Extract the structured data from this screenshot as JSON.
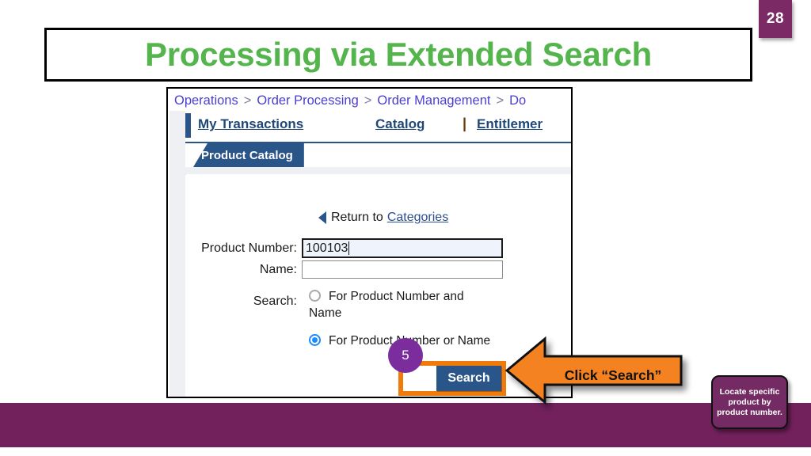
{
  "slide": {
    "page_number": "28",
    "title": "Processing via Extended Search",
    "title_color": "#54B54C",
    "band_color": "#72215C",
    "badge_color": "#7B2A66"
  },
  "app": {
    "breadcrumb": {
      "items": [
        "Operations",
        "Order Processing",
        "Order Management",
        "Do"
      ],
      "separator": ">"
    },
    "nav": {
      "links": [
        "My Transactions",
        "Catalog",
        "Entitlemer"
      ],
      "divider": "|"
    },
    "subtab": {
      "label": "Product Catalog"
    },
    "return_row": {
      "label": "Return to",
      "link": "Categories",
      "arrow_icon": "back-triangle-icon"
    },
    "form": {
      "product_number": {
        "label": "Product Number:",
        "value": "100103",
        "placeholder": ""
      },
      "name": {
        "label": "Name:",
        "value": "",
        "placeholder": ""
      },
      "search_mode": {
        "label": "Search:",
        "options": [
          {
            "label": "For Product Number and Name",
            "selected": false
          },
          {
            "label": "For Product Number or Name",
            "selected": true
          }
        ]
      },
      "search_button": "Search"
    }
  },
  "annotations": {
    "step_number": "5",
    "step_color": "#7B2D9E",
    "callout_text": "Click “Search”",
    "callout_color": "#F58220",
    "highlight_color": "#F07A0A",
    "note_text": "Locate specific product by product number.",
    "note_color": "#742B63"
  }
}
